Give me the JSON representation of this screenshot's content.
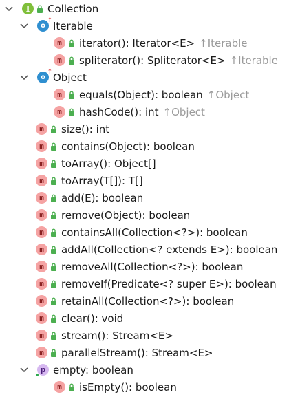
{
  "tree": {
    "root": {
      "label": "Collection",
      "badge": "I"
    },
    "iterable": {
      "label": "Iterable",
      "badge": "o",
      "methods": [
        {
          "sig": "iterator(): Iterator<E>",
          "from": "↑Iterable"
        },
        {
          "sig": "spliterator(): Spliterator<E>",
          "from": "↑Iterable"
        }
      ]
    },
    "object": {
      "label": "Object",
      "badge": "o",
      "methods": [
        {
          "sig": "equals(Object): boolean",
          "from": "↑Object"
        },
        {
          "sig": "hashCode(): int",
          "from": "↑Object"
        }
      ]
    },
    "methods": [
      "size(): int",
      "contains(Object): boolean",
      "toArray(): Object[]",
      "toArray(T[]): T[]",
      "add(E): boolean",
      "remove(Object): boolean",
      "containsAll(Collection<?>): boolean",
      "addAll(Collection<? extends E>): boolean",
      "removeAll(Collection<?>): boolean",
      "removeIf(Predicate<? super E>): boolean",
      "retainAll(Collection<?>): boolean",
      "clear(): void",
      "stream(): Stream<E>",
      "parallelStream(): Stream<E>"
    ],
    "property": {
      "label": "empty: boolean",
      "badge": "p",
      "getter": "isEmpty(): boolean"
    },
    "method_badge": "m"
  },
  "colors": {
    "interface_badge": "#7fbf3a",
    "object_badge": "#2f8fd0",
    "method_badge": "#f5a3a3",
    "property_badge": "#d6b8f0",
    "lock": "#4caf50",
    "inherited_text": "#9a9a9a"
  },
  "icons": {
    "chevron": "chevron-down-icon",
    "lock": "lock-icon"
  }
}
